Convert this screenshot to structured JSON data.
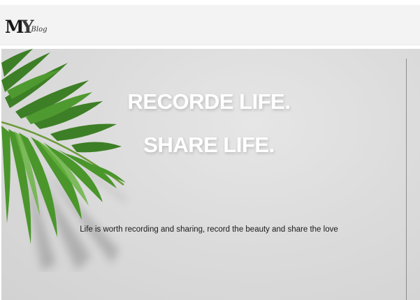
{
  "header": {
    "logo": {
      "mark_m": "M",
      "mark_y": "Y",
      "subtitle": "Blog"
    }
  },
  "hero": {
    "title_line_1": "RECORDE LIFE.",
    "title_line_2": "SHARE LIFE.",
    "tagline": "Life is worth recording and sharing, record the beauty and share the love",
    "background_color": "#dcdcdc",
    "leaf_color": "#3f8a2a",
    "decoration_icon": "palm-leaf-icon"
  }
}
